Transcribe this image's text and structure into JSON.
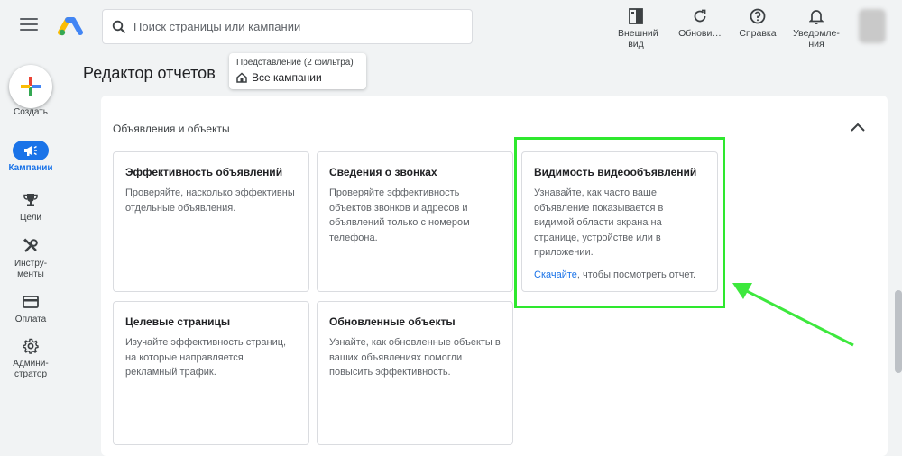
{
  "search": {
    "placeholder": "Поиск страницы или кампании"
  },
  "toolbar": {
    "appearance": "Внешний вид",
    "refresh": "Обнови…",
    "help": "Справка",
    "notifications": "Уведомле-ния"
  },
  "nav": {
    "create": "Создать",
    "campaigns": "Кампании",
    "goals": "Цели",
    "tools": "Инстру-менты",
    "billing": "Оплата",
    "admin": "Админи-стратор"
  },
  "header": {
    "title": "Редактор отчетов",
    "view_caption": "Представление (2 фильтра)",
    "view_value": "Все кампании"
  },
  "section": {
    "title": "Объявления и объекты",
    "cards": [
      {
        "title": "Эффективность объявлений",
        "desc": "Проверяйте, насколько эффективны отдельные объявления."
      },
      {
        "title": "Сведения о звонках",
        "desc": "Проверяйте эффективность объектов звонков и адресов и объявлений только с номером телефона."
      },
      {
        "title": "Видимость видеообъявлений",
        "desc": "Узнавайте, как часто ваше объявление показывается в видимой области экрана на странице, устройстве или в приложении.",
        "link": "Скачайте",
        "link_suffix": ", чтобы посмотреть отчет."
      },
      {
        "title": "Целевые страницы",
        "desc": "Изучайте эффективность страниц, на которые направляется рекламный трафик."
      },
      {
        "title": "Обновленные объекты",
        "desc": "Узнайте, как обновленные объекты в ваших объявлениях помогли повысить эффективность."
      }
    ]
  },
  "colors": {
    "accent": "#1a73e8",
    "highlight": "#2ee82e"
  }
}
